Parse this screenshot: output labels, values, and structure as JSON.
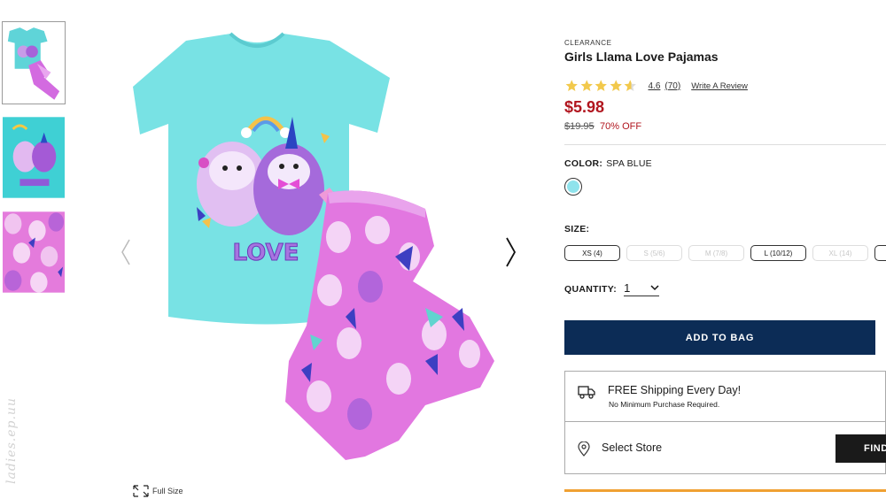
{
  "thumbnails": [
    {
      "name": "thumb-full-set",
      "active": true
    },
    {
      "name": "thumb-llama-graphic",
      "active": false
    },
    {
      "name": "thumb-pant-pattern",
      "active": false
    }
  ],
  "watermark": "ladies.ep.uu",
  "gallery": {
    "prev_icon": "chevron-left-icon",
    "next_icon": "chevron-right-icon",
    "fullsize_label": "Full Size",
    "fullsize_icon": "expand-icon",
    "shirt_text": "LOVE"
  },
  "product": {
    "badge": "CLEARANCE",
    "title": "Girls Llama Love Pajamas",
    "rating_value": "4.6",
    "rating_count": "(70)",
    "rating_stars": 4.6,
    "write_review": "Write A Review",
    "price": "$5.98",
    "original_price": "$19.95",
    "discount": "70% OFF",
    "color_label": "COLOR:",
    "color_value": "SPA BLUE",
    "swatch_color": "#8fe3ec",
    "size_label": "SIZE:",
    "sizes": [
      {
        "label": "XS (4)",
        "available": true
      },
      {
        "label": "S (5/6)",
        "available": false
      },
      {
        "label": "M (7/8)",
        "available": false
      },
      {
        "label": "L (10/12)",
        "available": true
      },
      {
        "label": "XL (14)",
        "available": false
      },
      {
        "label": "",
        "available": true
      }
    ],
    "quantity_label": "QUANTITY:",
    "quantity_value": "1",
    "add_to_bag": "ADD TO BAG"
  },
  "shipping": {
    "title": "FREE Shipping Every Day!",
    "subtitle": "No Minimum Purchase Required.",
    "icon": "delivery-truck-icon"
  },
  "store": {
    "label": "Select Store",
    "icon": "location-pin-icon",
    "find_button": "FIND"
  },
  "colors": {
    "brand_navy": "#0c2c56",
    "sale_red": "#b1161f",
    "star_gold": "#f2c94c",
    "accent_orange": "#f0a132"
  }
}
